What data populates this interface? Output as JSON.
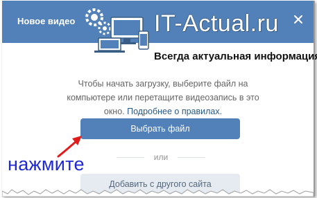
{
  "dialog": {
    "title": "Новое видео",
    "instructions": "Чтобы начать загрузку, выберите файл на компьютере или перетащите видеозапись в это окно.",
    "rules_link": "Подробнее о правилах.",
    "choose_file_label": "Выбрать файл",
    "divider_text": "или",
    "other_site_label": "Добавить с другого сайта"
  },
  "watermark": {
    "title": "IT-Actual.ru",
    "subtitle": "Всегда актуальная информация"
  },
  "annotation": {
    "text": "нажмите"
  },
  "colors": {
    "header": "#5181b8",
    "primary_button": "#5181b8",
    "secondary_button": "#e5ebf1",
    "link": "#2a5885",
    "annotation_text": "#1f29d6",
    "annotation_arrow": "#e01b1b"
  },
  "icons": {
    "close": "close-icon",
    "arrow": "red-arrow-icon"
  }
}
